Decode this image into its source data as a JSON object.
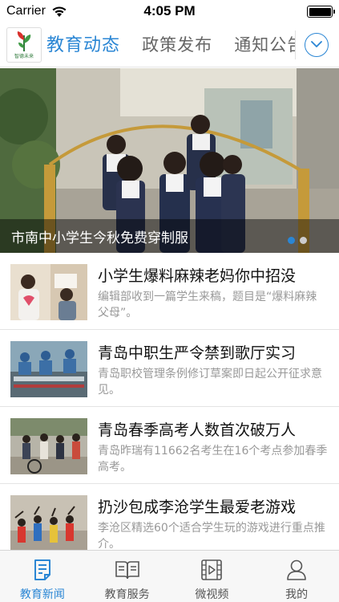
{
  "status_bar": {
    "carrier": "Carrier",
    "time": "4:05 PM",
    "battery_level": 1.0
  },
  "header": {
    "logo_text": "智德未来",
    "channel_tabs": [
      {
        "label": "教育动态",
        "active": true
      },
      {
        "label": "政策发布",
        "active": false
      },
      {
        "label": "通知公告",
        "active": false
      }
    ],
    "more_icon": "chevron-down-circle-icon"
  },
  "banner": {
    "caption": "市南中小学生今秋免费穿制服",
    "page_count": 2,
    "current_page": 1
  },
  "news": [
    {
      "title": "小学生爆料麻辣老妈你中招没",
      "summary": "编辑部收到一篇学生来稿，题目是“爆料麻辣父母”。"
    },
    {
      "title": "青岛中职生严令禁到歌厅实习",
      "summary": "青岛职校管理条例修订草案即日起公开征求意见。"
    },
    {
      "title": "青岛春季高考人数首次破万人",
      "summary": "青岛昨瑞有11662名考生在16个考点参加春季高考。"
    },
    {
      "title": "扔沙包成李沧学生最爱老游戏",
      "summary": "李沧区精选60个适合学生玩的游戏进行重点推介。"
    }
  ],
  "tab_bar": [
    {
      "label": "教育新闻",
      "icon": "news-document-icon",
      "active": true
    },
    {
      "label": "教育服务",
      "icon": "book-icon",
      "active": false
    },
    {
      "label": "微视频",
      "icon": "film-icon",
      "active": false
    },
    {
      "label": "我的",
      "icon": "person-icon",
      "active": false
    }
  ],
  "colors": {
    "accent": "#2a86d4",
    "inactive_text": "#666666",
    "summary_text": "#999999"
  }
}
